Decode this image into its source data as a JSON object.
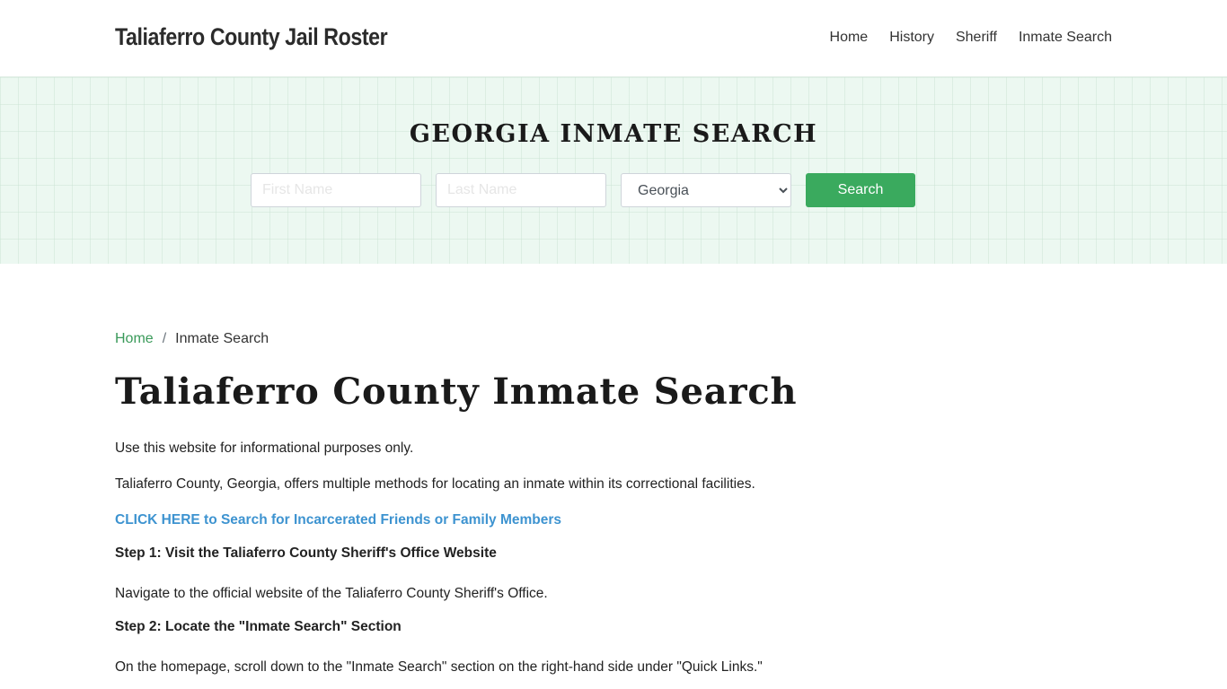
{
  "header": {
    "brand": "Taliaferro County Jail Roster",
    "nav": [
      "Home",
      "History",
      "Sheriff",
      "Inmate Search"
    ]
  },
  "hero": {
    "title": "GEORGIA INMATE SEARCH",
    "first_name_placeholder": "First Name",
    "last_name_placeholder": "Last Name",
    "state_selected": "Georgia",
    "search_label": "Search",
    "accent_color": "#3aaa5e"
  },
  "breadcrumb": {
    "home": "Home",
    "separator": "/",
    "current": "Inmate Search"
  },
  "main": {
    "title": "Taliaferro County Inmate Search",
    "disclaimer": "Use this website for informational purposes only.",
    "intro": "Taliaferro County, Georgia, offers multiple methods for locating an inmate within its correctional facilities.",
    "cta_link": "CLICK HERE to Search for Incarcerated Friends or Family Members",
    "steps": [
      {
        "heading": "Step 1: Visit the Taliaferro County Sheriff's Office Website",
        "text": "Navigate to the official website of the Taliaferro County Sheriff's Office."
      },
      {
        "heading": "Step 2: Locate the \"Inmate Search\" Section",
        "text": "On the homepage, scroll down to the \"Inmate Search\" section on the right-hand side under \"Quick Links.\""
      }
    ]
  }
}
